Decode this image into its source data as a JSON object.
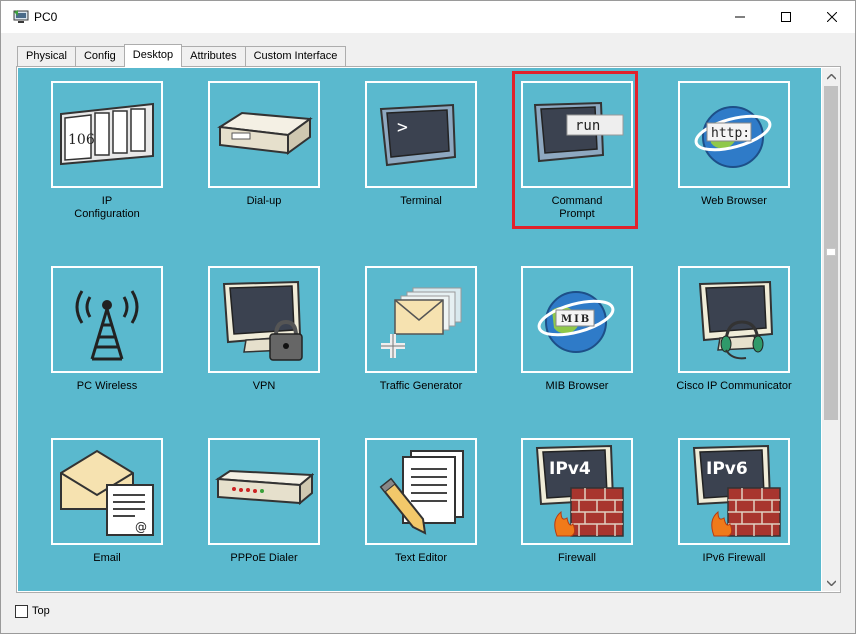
{
  "window": {
    "title": "PC0"
  },
  "tabs": [
    {
      "label": "Physical",
      "active": false
    },
    {
      "label": "Config",
      "active": false
    },
    {
      "label": "Desktop",
      "active": true
    },
    {
      "label": "Attributes",
      "active": false
    },
    {
      "label": "Custom Interface",
      "active": false
    }
  ],
  "apps": [
    {
      "name": "ip-configuration",
      "label_line1": "IP",
      "label_line2": "Configuration",
      "icon": "ip-config-icon",
      "icon_text": "106"
    },
    {
      "name": "dial-up",
      "label_line1": "Dial-up",
      "label_line2": "",
      "icon": "modem-icon"
    },
    {
      "name": "terminal",
      "label_line1": "Terminal",
      "label_line2": "",
      "icon": "terminal-icon",
      "icon_text": ">"
    },
    {
      "name": "command-prompt",
      "label_line1": "Command",
      "label_line2": "Prompt",
      "icon": "command-prompt-icon",
      "icon_text": "run"
    },
    {
      "name": "web-browser",
      "label_line1": "Web Browser",
      "label_line2": "",
      "icon": "web-browser-icon",
      "icon_text": "http:"
    },
    {
      "name": "pc-wireless",
      "label_line1": "PC Wireless",
      "label_line2": "",
      "icon": "wireless-antenna-icon"
    },
    {
      "name": "vpn",
      "label_line1": "VPN",
      "label_line2": "",
      "icon": "vpn-lock-icon"
    },
    {
      "name": "traffic-generator",
      "label_line1": "Traffic Generator",
      "label_line2": "",
      "icon": "envelopes-icon"
    },
    {
      "name": "mib-browser",
      "label_line1": "MIB Browser",
      "label_line2": "",
      "icon": "mib-browser-icon",
      "icon_text": "MIB"
    },
    {
      "name": "cisco-ip-communicator",
      "label_line1": "Cisco IP Communicator",
      "label_line2": "",
      "icon": "headset-monitor-icon"
    },
    {
      "name": "email",
      "label_line1": "Email",
      "label_line2": "",
      "icon": "email-icon",
      "icon_text": "@"
    },
    {
      "name": "pppoe-dialer",
      "label_line1": "PPPoE Dialer",
      "label_line2": "",
      "icon": "pppoe-device-icon"
    },
    {
      "name": "text-editor",
      "label_line1": "Text Editor",
      "label_line2": "",
      "icon": "text-editor-icon"
    },
    {
      "name": "firewall",
      "label_line1": "Firewall",
      "label_line2": "",
      "icon": "firewall-ipv4-icon",
      "icon_text": "IPv4"
    },
    {
      "name": "ipv6-firewall",
      "label_line1": "IPv6 Firewall",
      "label_line2": "",
      "icon": "firewall-ipv6-icon",
      "icon_text": "IPv6"
    }
  ],
  "highlighted_app": "command-prompt",
  "footer": {
    "top_checkbox_label": "Top",
    "top_checked": false
  },
  "colors": {
    "desktop_bg": "#5ab9ce",
    "highlight": "#e1212b"
  }
}
